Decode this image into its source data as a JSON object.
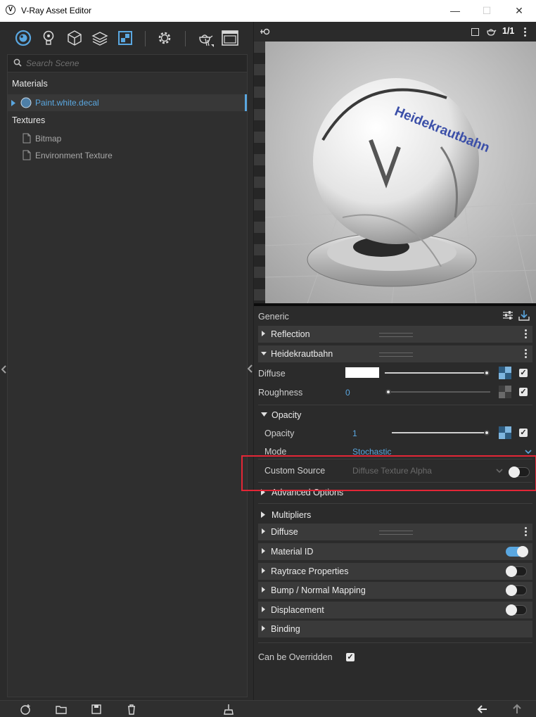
{
  "window": {
    "title": "V-Ray Asset Editor",
    "logo_glyph": "V",
    "minimize_glyph": "—",
    "maximize_glyph": "☐",
    "close_glyph": "✕"
  },
  "search": {
    "placeholder": "Search Scene"
  },
  "tree": {
    "materials_label": "Materials",
    "materials": [
      {
        "label": "Paint.white.decal"
      }
    ],
    "textures_label": "Textures",
    "textures": [
      {
        "label": "Bitmap"
      },
      {
        "label": "Environment Texture"
      }
    ]
  },
  "preview": {
    "text_on_ball": "Heidekrautbahn",
    "ratio_label": "1/1"
  },
  "properties": {
    "generic_label": "Generic",
    "sections_top": [
      {
        "label": "Reflection"
      },
      {
        "label": "Heidekrautbahn"
      }
    ],
    "diffuse_label": "Diffuse",
    "roughness_label": "Roughness",
    "roughness_value": "0",
    "opacity_section": "Opacity",
    "opacity_label": "Opacity",
    "opacity_value": "1",
    "mode_label": "Mode",
    "mode_value": "Stochastic",
    "custom_source_label": "Custom Source",
    "custom_source_value": "Diffuse Texture Alpha",
    "advanced_options": "Advanced Options",
    "multipliers": "Multipliers",
    "sections_bottom": [
      {
        "label": "Diffuse"
      },
      {
        "label": "Material ID"
      },
      {
        "label": "Raytrace Properties"
      },
      {
        "label": "Bump / Normal Mapping"
      },
      {
        "label": "Displacement"
      },
      {
        "label": "Binding"
      }
    ],
    "can_be_overridden": "Can be Overridden"
  },
  "colors": {
    "accent": "#5aa7e0",
    "highlight_box": "#e32636",
    "panel_bg": "#2b2b2b"
  },
  "icons": [
    "material-sphere-icon",
    "light-bulb-icon",
    "geometry-cube-icon",
    "layers-icon",
    "texture-checker-icon",
    "settings-gear-icon",
    "teapot-render-icon",
    "frame-buffer-icon"
  ]
}
